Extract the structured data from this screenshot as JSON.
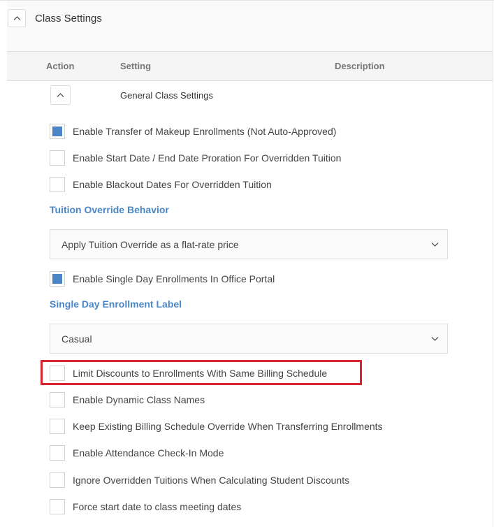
{
  "section": {
    "title": "Class Settings",
    "collapse_icon": "chevron-up-icon"
  },
  "table": {
    "columns": [
      "Action",
      "Setting",
      "Description"
    ]
  },
  "group": {
    "title": "General Class Settings",
    "collapse_icon": "chevron-up-icon"
  },
  "settings": {
    "makeup_transfer": {
      "label": "Enable Transfer of Makeup Enrollments (Not Auto-Approved)",
      "checked": true
    },
    "proration": {
      "label": "Enable Start Date / End Date Proration For Overridden Tuition",
      "checked": false
    },
    "blackout": {
      "label": "Enable Blackout Dates For Overridden Tuition",
      "checked": false
    },
    "tuition_override": {
      "label": "Tuition Override Behavior",
      "selected": "Apply Tuition Override as a flat-rate price"
    },
    "single_day": {
      "label": "Enable Single Day Enrollments In Office Portal",
      "checked": true
    },
    "single_day_label": {
      "label": "Single Day Enrollment Label",
      "selected": "Casual"
    },
    "limit_discounts": {
      "label": "Limit Discounts to Enrollments With Same Billing Schedule",
      "checked": false,
      "highlighted": true
    },
    "dynamic_names": {
      "label": "Enable Dynamic Class Names",
      "checked": false
    },
    "keep_billing": {
      "label": "Keep Existing Billing Schedule Override When Transferring Enrollments",
      "checked": false
    },
    "attendance": {
      "label": "Enable Attendance Check-In Mode",
      "checked": false
    },
    "ignore_overridden": {
      "label": "Ignore Overridden Tuitions When Calculating Student Discounts",
      "checked": false
    },
    "force_start": {
      "label": "Force start date to class meeting dates",
      "checked": false
    }
  },
  "colors": {
    "accent": "#4a86c5",
    "highlight": "#d9232d"
  }
}
